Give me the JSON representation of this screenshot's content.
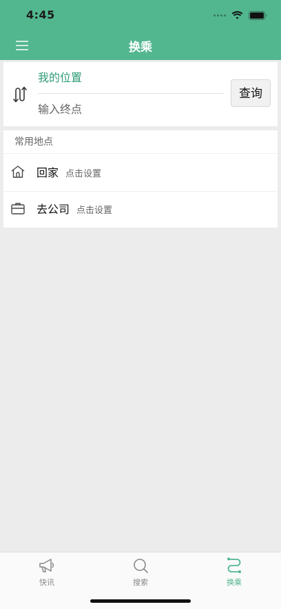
{
  "status": {
    "time": "4:45"
  },
  "nav": {
    "title": "换乘",
    "menu_icon": "hamburger-icon"
  },
  "route": {
    "origin": "我的位置",
    "destination_placeholder": "输入终点",
    "query_label": "查询",
    "swap_icon": "swap-route-icon"
  },
  "places": {
    "header": "常用地点",
    "items": [
      {
        "name": "回家",
        "hint": "点击设置",
        "icon": "home-icon"
      },
      {
        "name": "去公司",
        "hint": "点击设置",
        "icon": "briefcase-icon"
      }
    ]
  },
  "tabs": [
    {
      "label": "快讯",
      "icon": "megaphone-icon",
      "active": false
    },
    {
      "label": "搜索",
      "icon": "search-icon",
      "active": false
    },
    {
      "label": "换乘",
      "icon": "route-icon",
      "active": true
    }
  ],
  "colors": {
    "brand": "#52b68f",
    "origin_text": "#2f9b78",
    "background": "#ececec"
  }
}
